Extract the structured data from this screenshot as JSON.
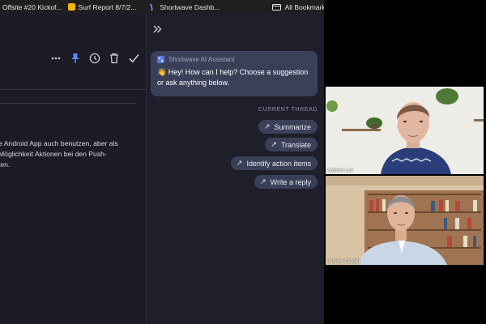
{
  "bookmarks_bar": {
    "items": [
      {
        "label": "Offsite #20 Kickof...",
        "icon": "document-icon",
        "color": "#1a73e8"
      },
      {
        "label": "Surf Report 8/7/2...",
        "icon": "slides-icon",
        "color": "#f6b704"
      },
      {
        "label": "Shortwave Dashb...",
        "icon": "shortwave-icon",
        "color": "#7aa0ff"
      }
    ],
    "all_bookmarks": {
      "label": "All Bookmarks",
      "icon": "folder-icon"
    }
  },
  "email": {
    "toolbar": [
      {
        "name": "more-icon"
      },
      {
        "name": "pin-icon",
        "color": "#5b8cff"
      },
      {
        "name": "snooze-clock-icon"
      },
      {
        "name": "trash-icon"
      },
      {
        "name": "done-check-icon"
      }
    ],
    "body_lines": [
      "e Android App auch benutzen, aber als",
      "Möglichkeit Aktionen bei den Push-",
      "ten."
    ]
  },
  "assistant": {
    "expand_icon": "double-chevron-right-icon",
    "title": "Shortwave AI Assistant",
    "greeting": "👋 Hey! How can I help? Choose a suggestion or ask anything below.",
    "thread_label": "CURRENT THREAD",
    "suggestions": [
      {
        "label": "Summarize"
      },
      {
        "label": "Translate"
      },
      {
        "label": "Identify action items"
      },
      {
        "label": "Write a reply"
      }
    ]
  },
  "video_call": {
    "participants": [
      {
        "name": "Andrew Lee"
      },
      {
        "name": "Jeremy Caplan"
      }
    ]
  }
}
